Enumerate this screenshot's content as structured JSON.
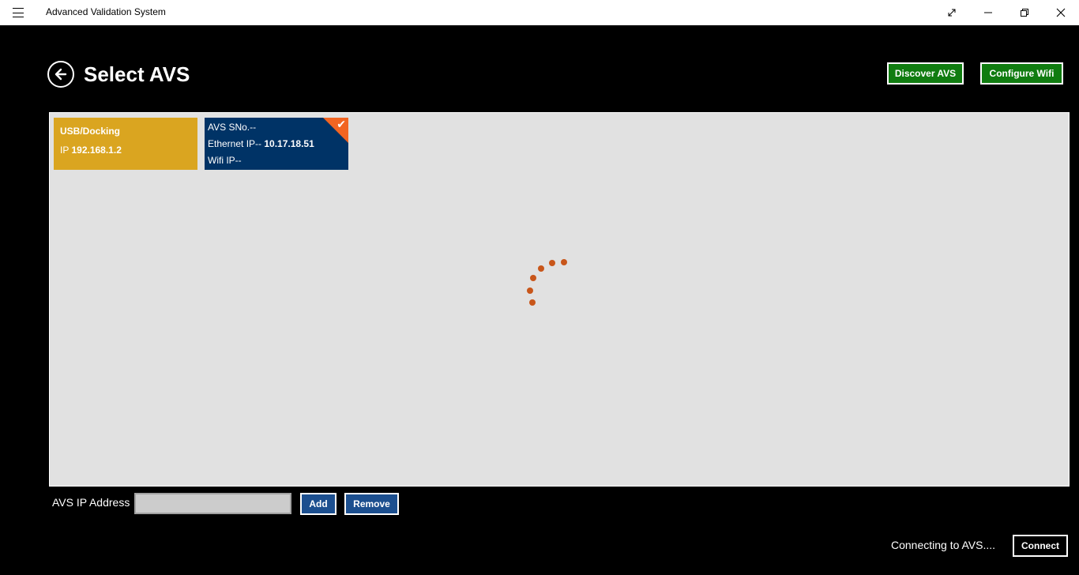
{
  "titlebar": {
    "title": "Advanced Validation System",
    "icons": [
      "hamburger-icon",
      "fullscreen-icon",
      "minimize-icon",
      "restore-icon",
      "close-icon"
    ]
  },
  "header": {
    "title": "Select AVS",
    "discover_label": "Discover AVS",
    "configure_label": "Configure Wifi"
  },
  "devices": {
    "usb": {
      "title": "USB/Docking",
      "ip_label": "IP",
      "ip_value": "192.168.1.2"
    },
    "avs": {
      "sno_label": "AVS SNo.--",
      "eth_label": "Ethernet IP--",
      "eth_value": "10.17.18.51",
      "wifi_label": "Wifi IP--",
      "selected": true
    }
  },
  "form": {
    "ip_label": "AVS IP Address",
    "ip_value": "",
    "add_label": "Add",
    "remove_label": "Remove"
  },
  "footer": {
    "status": "Connecting to AVS....",
    "connect_label": "Connect"
  },
  "colors": {
    "usb_tile": "#daa520",
    "avs_tile": "#003366",
    "accent_green": "#107c10",
    "button_blue": "#1c4f8f",
    "spinner": "#c8561a",
    "check_corner": "#f26522",
    "panel": "#e1e1e1"
  }
}
